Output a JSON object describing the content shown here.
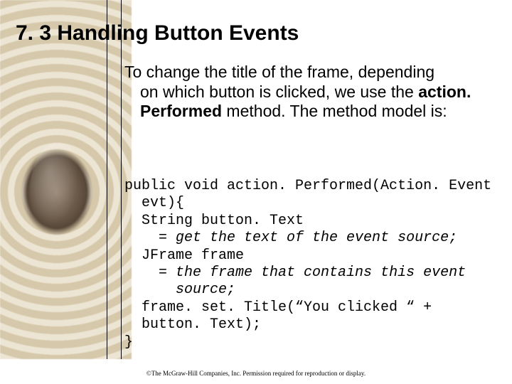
{
  "heading": "7. 3 Handling Button Events",
  "body": {
    "line1": "To change the title of the frame, depending",
    "rest_pre": "on which button is clicked, we use the ",
    "bold": "action. Performed",
    "rest_post": " method. The method model is:"
  },
  "code": {
    "l1": "public void action. Performed(Action. Event",
    "l2": "  evt){",
    "l3": "  String button. Text",
    "l4a": "    = ",
    "l4b": "get the text of the event source;",
    "l5": "  JFrame frame",
    "l6a": "    = ",
    "l6b": "the frame that contains this event",
    "l7": "      source;",
    "l8": "  frame. set. Title(“You clicked “ +",
    "l9": "  button. Text);",
    "l10": "}"
  },
  "footer": "©The McGraw-Hill Companies, Inc. Permission required for reproduction or display."
}
